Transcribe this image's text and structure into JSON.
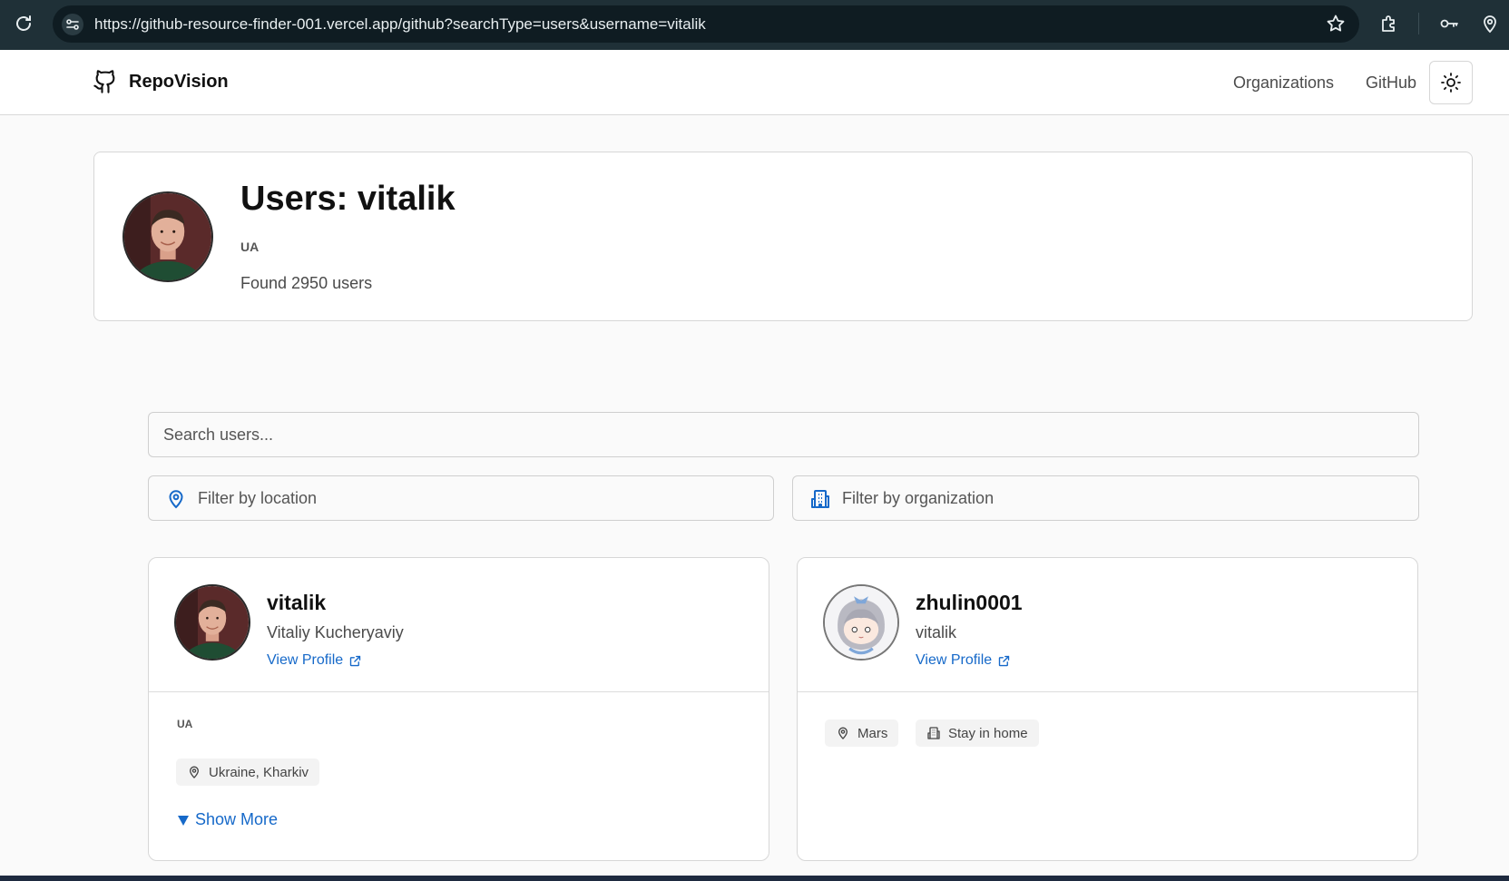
{
  "browser": {
    "url": "https://github-resource-finder-001.vercel.app/github?searchType=users&username=vitalik"
  },
  "header": {
    "brand": "RepoVision",
    "nav": {
      "organizations": "Organizations",
      "github": "GitHub"
    }
  },
  "summary": {
    "title": "Users: vitalik",
    "code": "UA",
    "found": "Found 2950 users"
  },
  "search": {
    "placeholder": "Search users...",
    "location_placeholder": "Filter by location",
    "organization_placeholder": "Filter by organization"
  },
  "users": [
    {
      "login": "vitalik",
      "name": "Vitaliy Kucheryaviy",
      "link": "View Profile",
      "code": "UA",
      "location": "Ukraine, Kharkiv",
      "show_more": "Show More"
    },
    {
      "login": "zhulin0001",
      "name": "vitalik",
      "link": "View Profile",
      "location": "Mars",
      "company": "Stay in home"
    }
  ],
  "colors": {
    "accent": "#1669c9",
    "chrome": "#1f3037"
  }
}
